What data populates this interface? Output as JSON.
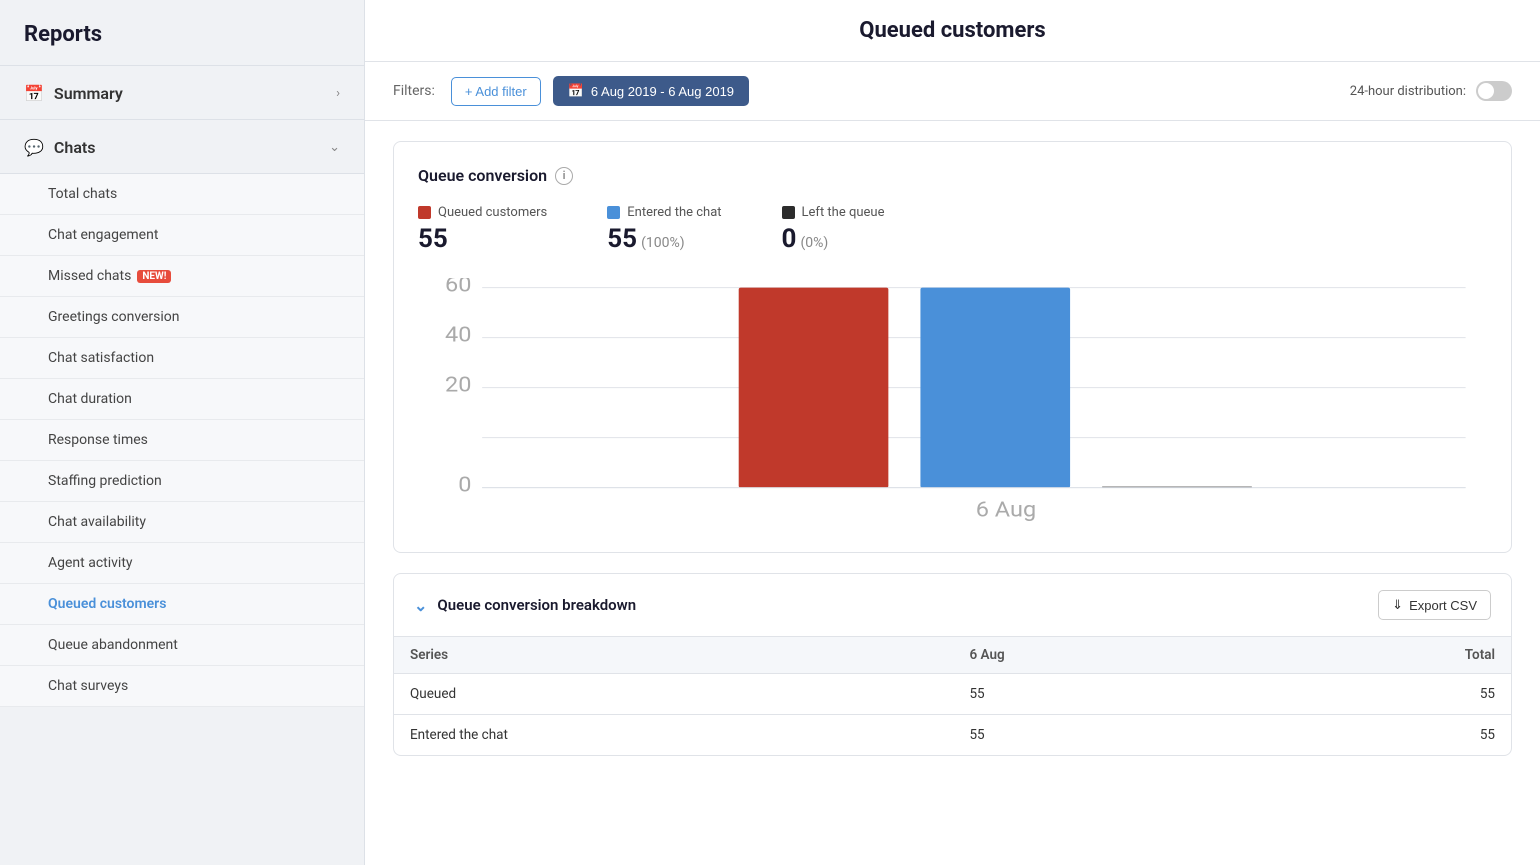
{
  "app": {
    "title": "Reports"
  },
  "sidebar": {
    "summary_label": "Summary",
    "chats_label": "Chats",
    "nav_items": [
      {
        "id": "total-chats",
        "label": "Total chats",
        "active": false,
        "new": false
      },
      {
        "id": "chat-engagement",
        "label": "Chat engagement",
        "active": false,
        "new": false
      },
      {
        "id": "missed-chats",
        "label": "Missed chats",
        "active": false,
        "new": true
      },
      {
        "id": "greetings-conversion",
        "label": "Greetings conversion",
        "active": false,
        "new": false
      },
      {
        "id": "chat-satisfaction",
        "label": "Chat satisfaction",
        "active": false,
        "new": false
      },
      {
        "id": "chat-duration",
        "label": "Chat duration",
        "active": false,
        "new": false
      },
      {
        "id": "response-times",
        "label": "Response times",
        "active": false,
        "new": false
      },
      {
        "id": "staffing-prediction",
        "label": "Staffing prediction",
        "active": false,
        "new": false
      },
      {
        "id": "chat-availability",
        "label": "Chat availability",
        "active": false,
        "new": false
      },
      {
        "id": "agent-activity",
        "label": "Agent activity",
        "active": false,
        "new": false
      },
      {
        "id": "queued-customers",
        "label": "Queued customers",
        "active": true,
        "new": false
      },
      {
        "id": "queue-abandonment",
        "label": "Queue abandonment",
        "active": false,
        "new": false
      },
      {
        "id": "chat-surveys",
        "label": "Chat surveys",
        "active": false,
        "new": false
      }
    ]
  },
  "page": {
    "title": "Queued customers"
  },
  "filters": {
    "label": "Filters:",
    "add_filter_label": "+ Add filter",
    "date_range": "6 Aug 2019 - 6 Aug 2019",
    "distribution_label": "24-hour distribution:"
  },
  "chart": {
    "title": "Queue conversion",
    "legend": [
      {
        "id": "queued",
        "label": "Queued customers",
        "color": "#c0392b",
        "value": "55",
        "pct": ""
      },
      {
        "id": "entered",
        "label": "Entered the chat",
        "color": "#4a90d9",
        "value": "55",
        "pct": "(100%)"
      },
      {
        "id": "left",
        "label": "Left the queue",
        "color": "#2c2c2c",
        "value": "0",
        "pct": "(0%)"
      }
    ],
    "y_axis": [
      "60",
      "40",
      "20",
      "0"
    ],
    "x_label": "6 Aug",
    "bars": [
      {
        "label": "Queued",
        "color": "#c0392b",
        "height_pct": 91
      },
      {
        "label": "Entered",
        "color": "#4a90d9",
        "height_pct": 91
      },
      {
        "label": "Left",
        "color": "#2c2c2c",
        "height_pct": 0
      }
    ]
  },
  "breakdown": {
    "title": "Queue conversion breakdown",
    "export_label": "Export CSV",
    "table_headers": [
      "Series",
      "6 Aug",
      "Total"
    ],
    "rows": [
      {
        "series": "Queued",
        "aug6": "55",
        "total": "55"
      },
      {
        "series": "Entered the chat",
        "aug6": "55",
        "total": "55"
      }
    ]
  },
  "icons": {
    "calendar": "📅",
    "download": "⬇",
    "info": "i",
    "plus": "+"
  }
}
